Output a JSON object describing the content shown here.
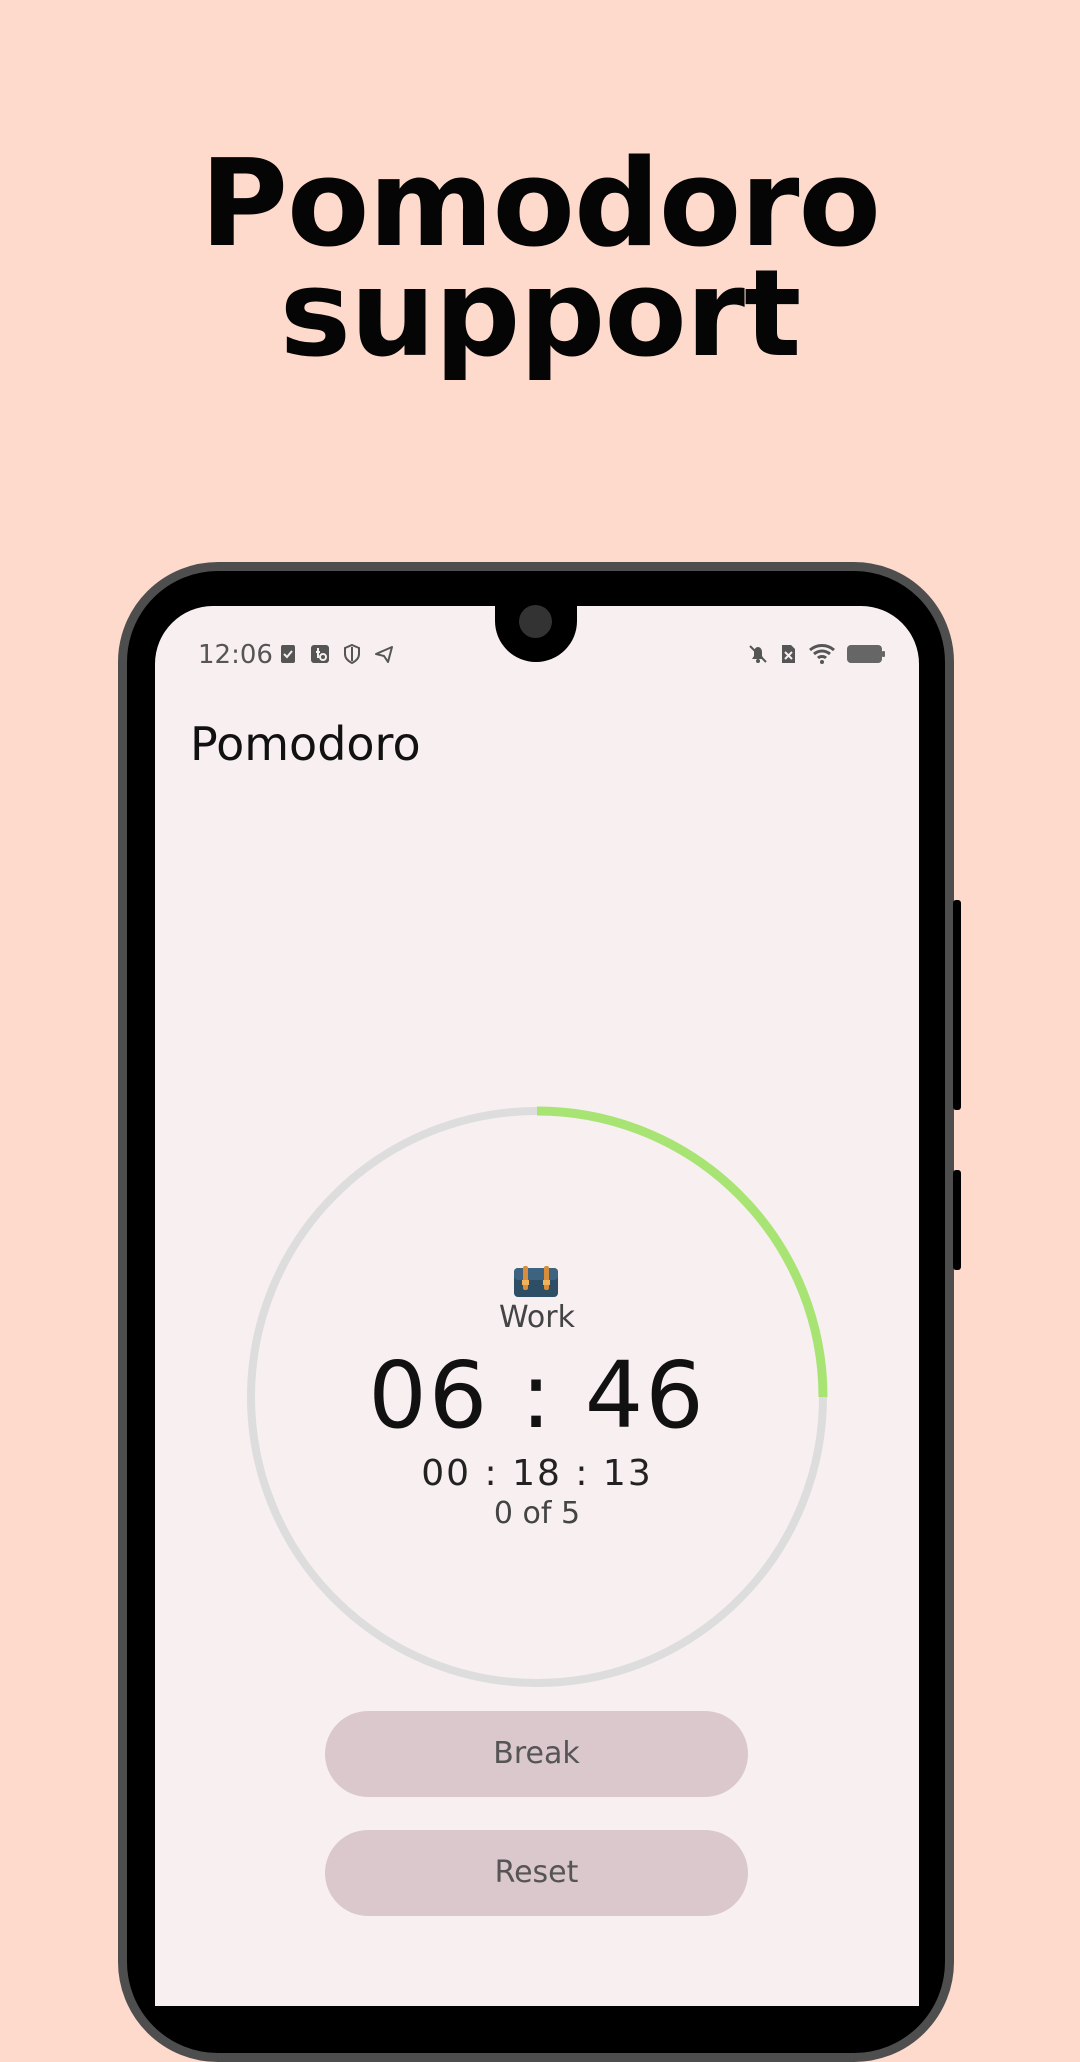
{
  "promo": {
    "headline_line1": "Pomodoro",
    "headline_line2": "support"
  },
  "status_bar": {
    "time": "12:06",
    "left_icons": [
      "task-done-icon",
      "usb-settings-icon",
      "shield-icon",
      "telegram-send-icon"
    ],
    "right_icons": [
      "bell-off-icon",
      "no-sim-icon",
      "wifi-icon",
      "battery-icon"
    ]
  },
  "app": {
    "title": "Pomodoro"
  },
  "timer": {
    "mode_icon": "briefcase-icon",
    "mode_label": "Work",
    "remaining": "06 : 46",
    "total_elapsed": "00 : 18 : 13",
    "sessions": "0 of  5",
    "progress_fraction": 0.25,
    "progress_color": "#a8e474",
    "track_color": "#dddddd"
  },
  "actions": {
    "break_label": "Break",
    "reset_label": "Reset"
  },
  "colors": {
    "page_background": "#fedacd",
    "screen_background": "#f8eff0",
    "button_background": "#dbc8cc"
  }
}
